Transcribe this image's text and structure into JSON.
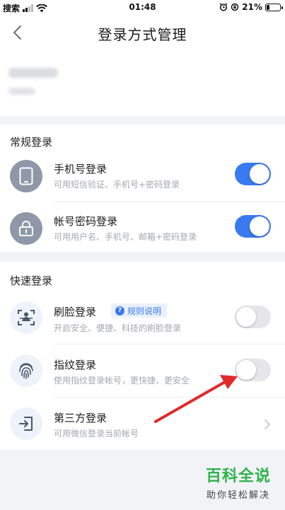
{
  "status_bar": {
    "carrier": "搜索",
    "time": "01:48",
    "battery_percent": "21%",
    "battery_level": 0.21
  },
  "nav": {
    "title": "登录方式管理"
  },
  "regular": {
    "title": "常规登录",
    "items": [
      {
        "title": "手机号登录",
        "subtitle": "可用短信验证、手机号+密码登录",
        "enabled": true
      },
      {
        "title": "帐号密码登录",
        "subtitle": "可用用户名、手机号、邮箱+密码登录",
        "enabled": true
      }
    ]
  },
  "quick": {
    "title": "快速登录",
    "face": {
      "title": "刷脸登录",
      "rule_label": "规则说明",
      "subtitle": "开启安全、便捷、科技的刷脸登录",
      "enabled": false
    },
    "fingerprint": {
      "title": "指纹登录",
      "subtitle": "使用指纹登录帐号，更快捷、更安全",
      "enabled": false
    },
    "third_party": {
      "title": "第三方登录",
      "subtitle": "可用微信登录当前帐号"
    }
  },
  "watermark": {
    "title": "百科全说",
    "subtitle": "助你轻松解决"
  },
  "colors": {
    "accent": "#3a7af0",
    "watermark_green": "#2fb24a",
    "arrow_red": "#e02a2a"
  }
}
